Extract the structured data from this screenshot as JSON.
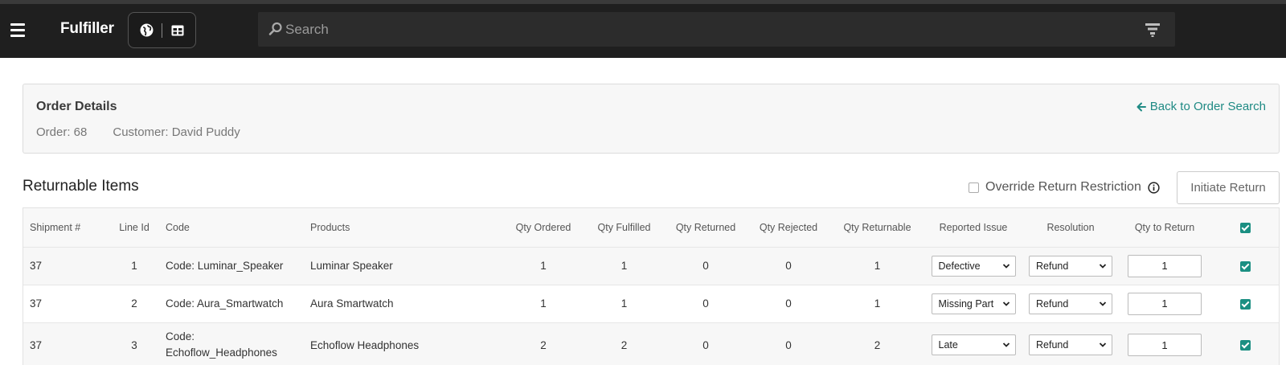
{
  "app": {
    "title": "Fulfiller",
    "search_placeholder": "Search"
  },
  "order": {
    "heading": "Order Details",
    "order_label": "Order: 68",
    "customer_label": "Customer: David Puddy",
    "back_link": "Back to Order Search"
  },
  "returnable": {
    "heading": "Returnable Items",
    "override_label": "Override Return Restriction",
    "initiate_button": "Initiate Return",
    "columns": {
      "shipment": "Shipment #",
      "line_id": "Line Id",
      "code": "Code",
      "products": "Products",
      "qty_ordered": "Qty Ordered",
      "qty_fulfilled": "Qty Fulfilled",
      "qty_returned": "Qty Returned",
      "qty_rejected": "Qty Rejected",
      "qty_returnable": "Qty Returnable",
      "reported_issue": "Reported Issue",
      "resolution": "Resolution",
      "qty_to_return": "Qty to Return"
    },
    "rows": [
      {
        "shipment": "37",
        "line_id": "1",
        "code_prefix": "Code: ",
        "code": "Luminar_Speaker",
        "product": "Luminar Speaker",
        "qty_ordered": "1",
        "qty_fulfilled": "1",
        "qty_returned": "0",
        "qty_rejected": "0",
        "qty_returnable": "1",
        "reported_issue": "Defective",
        "resolution": "Refund",
        "qty_to_return": "1",
        "selected": true
      },
      {
        "shipment": "37",
        "line_id": "2",
        "code_prefix": "Code: ",
        "code": "Aura_Smartwatch",
        "product": "Aura Smartwatch",
        "qty_ordered": "1",
        "qty_fulfilled": "1",
        "qty_returned": "0",
        "qty_rejected": "0",
        "qty_returnable": "1",
        "reported_issue": "Missing Part",
        "resolution": "Refund",
        "qty_to_return": "1",
        "selected": true
      },
      {
        "shipment": "37",
        "line_id": "3",
        "code_prefix": "Code:",
        "code": "Echoflow_Headphones",
        "product": "Echoflow Headphones",
        "qty_ordered": "2",
        "qty_fulfilled": "2",
        "qty_returned": "0",
        "qty_rejected": "0",
        "qty_returnable": "2",
        "reported_issue": "Late",
        "resolution": "Refund",
        "qty_to_return": "1",
        "selected": true
      }
    ]
  },
  "colors": {
    "topbar": "#1f1f1f",
    "accent": "#1f8a84",
    "checkbox": "#1b8f82"
  },
  "icons": {
    "menu": "hamburger-icon",
    "globe": "globe-icon",
    "table": "table-icon",
    "search": "search-icon",
    "filter": "filter-icon",
    "back": "arrow-left-icon",
    "info": "info-icon",
    "dropdown": "chevron-down-icon"
  }
}
